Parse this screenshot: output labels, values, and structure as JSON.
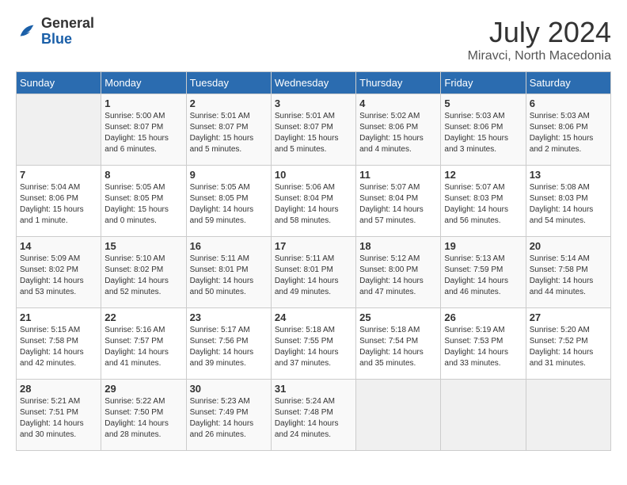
{
  "header": {
    "logo_general": "General",
    "logo_blue": "Blue",
    "month_year": "July 2024",
    "location": "Miravci, North Macedonia"
  },
  "weekdays": [
    "Sunday",
    "Monday",
    "Tuesday",
    "Wednesday",
    "Thursday",
    "Friday",
    "Saturday"
  ],
  "weeks": [
    [
      {
        "day": "",
        "sunrise": "",
        "sunset": "",
        "daylight": ""
      },
      {
        "day": "1",
        "sunrise": "Sunrise: 5:00 AM",
        "sunset": "Sunset: 8:07 PM",
        "daylight": "Daylight: 15 hours and 6 minutes."
      },
      {
        "day": "2",
        "sunrise": "Sunrise: 5:01 AM",
        "sunset": "Sunset: 8:07 PM",
        "daylight": "Daylight: 15 hours and 5 minutes."
      },
      {
        "day": "3",
        "sunrise": "Sunrise: 5:01 AM",
        "sunset": "Sunset: 8:07 PM",
        "daylight": "Daylight: 15 hours and 5 minutes."
      },
      {
        "day": "4",
        "sunrise": "Sunrise: 5:02 AM",
        "sunset": "Sunset: 8:06 PM",
        "daylight": "Daylight: 15 hours and 4 minutes."
      },
      {
        "day": "5",
        "sunrise": "Sunrise: 5:03 AM",
        "sunset": "Sunset: 8:06 PM",
        "daylight": "Daylight: 15 hours and 3 minutes."
      },
      {
        "day": "6",
        "sunrise": "Sunrise: 5:03 AM",
        "sunset": "Sunset: 8:06 PM",
        "daylight": "Daylight: 15 hours and 2 minutes."
      }
    ],
    [
      {
        "day": "7",
        "sunrise": "Sunrise: 5:04 AM",
        "sunset": "Sunset: 8:06 PM",
        "daylight": "Daylight: 15 hours and 1 minute."
      },
      {
        "day": "8",
        "sunrise": "Sunrise: 5:05 AM",
        "sunset": "Sunset: 8:05 PM",
        "daylight": "Daylight: 15 hours and 0 minutes."
      },
      {
        "day": "9",
        "sunrise": "Sunrise: 5:05 AM",
        "sunset": "Sunset: 8:05 PM",
        "daylight": "Daylight: 14 hours and 59 minutes."
      },
      {
        "day": "10",
        "sunrise": "Sunrise: 5:06 AM",
        "sunset": "Sunset: 8:04 PM",
        "daylight": "Daylight: 14 hours and 58 minutes."
      },
      {
        "day": "11",
        "sunrise": "Sunrise: 5:07 AM",
        "sunset": "Sunset: 8:04 PM",
        "daylight": "Daylight: 14 hours and 57 minutes."
      },
      {
        "day": "12",
        "sunrise": "Sunrise: 5:07 AM",
        "sunset": "Sunset: 8:03 PM",
        "daylight": "Daylight: 14 hours and 56 minutes."
      },
      {
        "day": "13",
        "sunrise": "Sunrise: 5:08 AM",
        "sunset": "Sunset: 8:03 PM",
        "daylight": "Daylight: 14 hours and 54 minutes."
      }
    ],
    [
      {
        "day": "14",
        "sunrise": "Sunrise: 5:09 AM",
        "sunset": "Sunset: 8:02 PM",
        "daylight": "Daylight: 14 hours and 53 minutes."
      },
      {
        "day": "15",
        "sunrise": "Sunrise: 5:10 AM",
        "sunset": "Sunset: 8:02 PM",
        "daylight": "Daylight: 14 hours and 52 minutes."
      },
      {
        "day": "16",
        "sunrise": "Sunrise: 5:11 AM",
        "sunset": "Sunset: 8:01 PM",
        "daylight": "Daylight: 14 hours and 50 minutes."
      },
      {
        "day": "17",
        "sunrise": "Sunrise: 5:11 AM",
        "sunset": "Sunset: 8:01 PM",
        "daylight": "Daylight: 14 hours and 49 minutes."
      },
      {
        "day": "18",
        "sunrise": "Sunrise: 5:12 AM",
        "sunset": "Sunset: 8:00 PM",
        "daylight": "Daylight: 14 hours and 47 minutes."
      },
      {
        "day": "19",
        "sunrise": "Sunrise: 5:13 AM",
        "sunset": "Sunset: 7:59 PM",
        "daylight": "Daylight: 14 hours and 46 minutes."
      },
      {
        "day": "20",
        "sunrise": "Sunrise: 5:14 AM",
        "sunset": "Sunset: 7:58 PM",
        "daylight": "Daylight: 14 hours and 44 minutes."
      }
    ],
    [
      {
        "day": "21",
        "sunrise": "Sunrise: 5:15 AM",
        "sunset": "Sunset: 7:58 PM",
        "daylight": "Daylight: 14 hours and 42 minutes."
      },
      {
        "day": "22",
        "sunrise": "Sunrise: 5:16 AM",
        "sunset": "Sunset: 7:57 PM",
        "daylight": "Daylight: 14 hours and 41 minutes."
      },
      {
        "day": "23",
        "sunrise": "Sunrise: 5:17 AM",
        "sunset": "Sunset: 7:56 PM",
        "daylight": "Daylight: 14 hours and 39 minutes."
      },
      {
        "day": "24",
        "sunrise": "Sunrise: 5:18 AM",
        "sunset": "Sunset: 7:55 PM",
        "daylight": "Daylight: 14 hours and 37 minutes."
      },
      {
        "day": "25",
        "sunrise": "Sunrise: 5:18 AM",
        "sunset": "Sunset: 7:54 PM",
        "daylight": "Daylight: 14 hours and 35 minutes."
      },
      {
        "day": "26",
        "sunrise": "Sunrise: 5:19 AM",
        "sunset": "Sunset: 7:53 PM",
        "daylight": "Daylight: 14 hours and 33 minutes."
      },
      {
        "day": "27",
        "sunrise": "Sunrise: 5:20 AM",
        "sunset": "Sunset: 7:52 PM",
        "daylight": "Daylight: 14 hours and 31 minutes."
      }
    ],
    [
      {
        "day": "28",
        "sunrise": "Sunrise: 5:21 AM",
        "sunset": "Sunset: 7:51 PM",
        "daylight": "Daylight: 14 hours and 30 minutes."
      },
      {
        "day": "29",
        "sunrise": "Sunrise: 5:22 AM",
        "sunset": "Sunset: 7:50 PM",
        "daylight": "Daylight: 14 hours and 28 minutes."
      },
      {
        "day": "30",
        "sunrise": "Sunrise: 5:23 AM",
        "sunset": "Sunset: 7:49 PM",
        "daylight": "Daylight: 14 hours and 26 minutes."
      },
      {
        "day": "31",
        "sunrise": "Sunrise: 5:24 AM",
        "sunset": "Sunset: 7:48 PM",
        "daylight": "Daylight: 14 hours and 24 minutes."
      },
      {
        "day": "",
        "sunrise": "",
        "sunset": "",
        "daylight": ""
      },
      {
        "day": "",
        "sunrise": "",
        "sunset": "",
        "daylight": ""
      },
      {
        "day": "",
        "sunrise": "",
        "sunset": "",
        "daylight": ""
      }
    ]
  ]
}
